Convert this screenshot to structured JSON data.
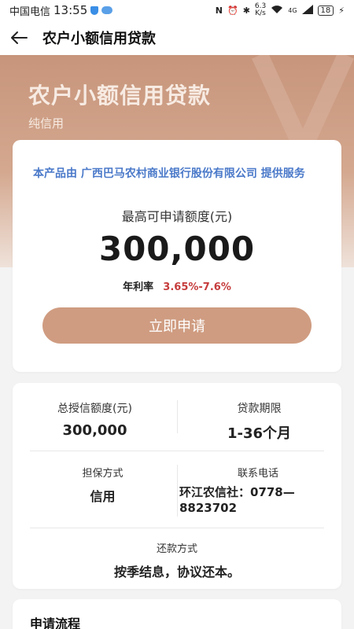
{
  "status_bar": {
    "carrier": "中国电信",
    "time": "13:55",
    "network_speed_top": "6.3",
    "network_speed_bottom": "K/s",
    "signal_label": "4G",
    "battery": "18"
  },
  "nav": {
    "title": "农户小额信用贷款"
  },
  "hero": {
    "title": "农户小额信用贷款",
    "subtitle": "纯信用"
  },
  "main_card": {
    "provider_text": "本产品由 广西巴马农村商业银行股份有限公司 提供服务",
    "amount_label": "最高可申请额度(元)",
    "amount_value": "300,000",
    "rate_label": "年利率",
    "rate_value": "3.65%-7.6%",
    "apply_button": "立即申请"
  },
  "info_card": {
    "total_credit_label": "总授信额度(元)",
    "total_credit_value": "300,000",
    "term_label": "贷款期限",
    "term_value": "1-36个月",
    "guarantee_label": "担保方式",
    "guarantee_value": "信用",
    "phone_label": "联系电话",
    "phone_value": "环江农信社：0778—8823702",
    "repay_label": "还款方式",
    "repay_value": "按季结息，协议还本。"
  },
  "process_card": {
    "title": "申请流程"
  },
  "colors": {
    "accent": "#cf9c81",
    "provider_blue": "#4a79c9",
    "rate_red": "#c63c3c"
  }
}
